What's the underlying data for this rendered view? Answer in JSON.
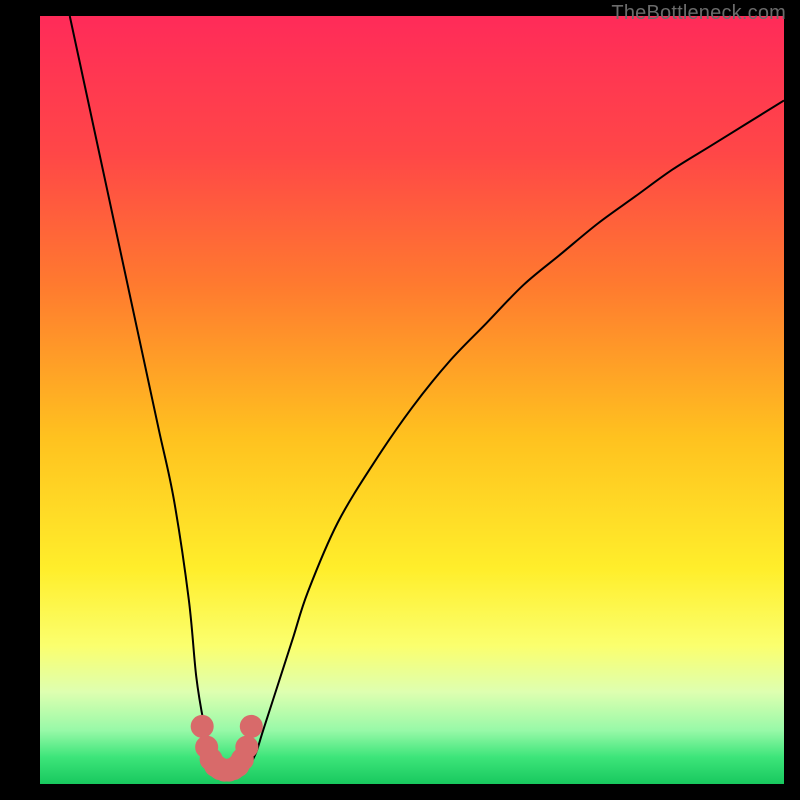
{
  "attribution": "TheBottleneck.com",
  "colors": {
    "black": "#000000",
    "curve": "#000000",
    "marker_fill": "#d86a6a",
    "marker_stroke": "#d86a6a",
    "gradient_stops": [
      {
        "offset": 0.0,
        "color": "#ff2b59"
      },
      {
        "offset": 0.18,
        "color": "#ff4747"
      },
      {
        "offset": 0.35,
        "color": "#ff7a2f"
      },
      {
        "offset": 0.55,
        "color": "#ffc21f"
      },
      {
        "offset": 0.72,
        "color": "#ffee2b"
      },
      {
        "offset": 0.82,
        "color": "#fbff6e"
      },
      {
        "offset": 0.88,
        "color": "#deffb0"
      },
      {
        "offset": 0.93,
        "color": "#98f9a8"
      },
      {
        "offset": 0.965,
        "color": "#3de57a"
      },
      {
        "offset": 1.0,
        "color": "#18c85e"
      }
    ]
  },
  "chart_data": {
    "type": "line",
    "title": "",
    "xlabel": "",
    "ylabel": "",
    "xlim": [
      0,
      100
    ],
    "ylim": [
      0,
      100
    ],
    "grid": false,
    "legend": false,
    "series": [
      {
        "name": "bottleneck-curve",
        "x": [
          4,
          6,
          8,
          10,
          12,
          14,
          16,
          18,
          20,
          21,
          22,
          23,
          24,
          25,
          26,
          27,
          28,
          29,
          30,
          32,
          34,
          36,
          40,
          45,
          50,
          55,
          60,
          65,
          70,
          75,
          80,
          85,
          90,
          95,
          100
        ],
        "y": [
          100,
          91,
          82,
          73,
          64,
          55,
          46,
          37,
          24,
          14,
          8,
          4,
          2.2,
          1.8,
          1.7,
          1.8,
          2.3,
          4,
          7,
          13,
          19,
          25,
          34,
          42,
          49,
          55,
          60,
          65,
          69,
          73,
          76.5,
          80,
          83,
          86,
          89
        ]
      }
    ],
    "markers": {
      "name": "bottleneck-markers",
      "x": [
        21.8,
        22.4,
        23.0,
        23.6,
        24.2,
        24.8,
        25.4,
        26.0,
        26.6,
        27.2,
        27.8,
        28.4
      ],
      "y": [
        7.5,
        4.8,
        3.2,
        2.4,
        2.0,
        1.8,
        1.8,
        2.0,
        2.4,
        3.2,
        4.8,
        7.5
      ],
      "radius": 11
    }
  }
}
